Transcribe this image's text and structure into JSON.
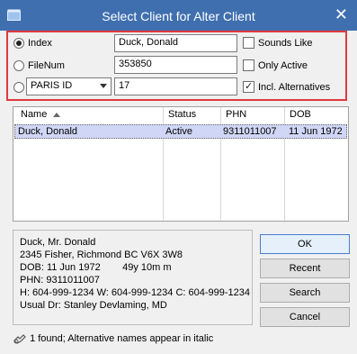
{
  "window": {
    "title": "Select Client for Alter Client",
    "icon": "window-icon",
    "close_icon": "close-icon"
  },
  "criteria": {
    "index_label": "Index",
    "index_value": "Duck, Donald",
    "filenum_label": "FileNum",
    "filenum_value": "353850",
    "id_type_selected": "PARIS ID",
    "id_value": "17",
    "sounds_like": "Sounds Like",
    "only_active": "Only Active",
    "incl_alternatives": "Incl. Alternatives"
  },
  "results": {
    "columns": [
      "Name",
      "Status",
      "PHN",
      "DOB"
    ],
    "rows": [
      {
        "name": "Duck, Donald",
        "status": "Active",
        "phn": "9311011007",
        "dob": "11 Jun 1972"
      }
    ]
  },
  "details": {
    "lines": [
      "Duck, Mr. Donald",
      "2345 Fisher, Richmond BC V6X 3W8",
      "DOB: 11 Jun 1972        49y 10m m",
      "PHN: 9311011007",
      "H: 604-999-1234 W: 604-999-1234 C: 604-999-1234",
      "Usual Dr: Stanley Devlaming, MD"
    ]
  },
  "buttons": {
    "ok": "OK",
    "recent": "Recent",
    "search": "Search",
    "cancel": "Cancel"
  },
  "status": {
    "text": "1 found; Alternative names appear in italic",
    "icon": "hand-icon"
  },
  "colors": {
    "titlebar": "#3f6faf",
    "highlight_border": "#e0393e",
    "selected_row": "#d0d6f5"
  }
}
